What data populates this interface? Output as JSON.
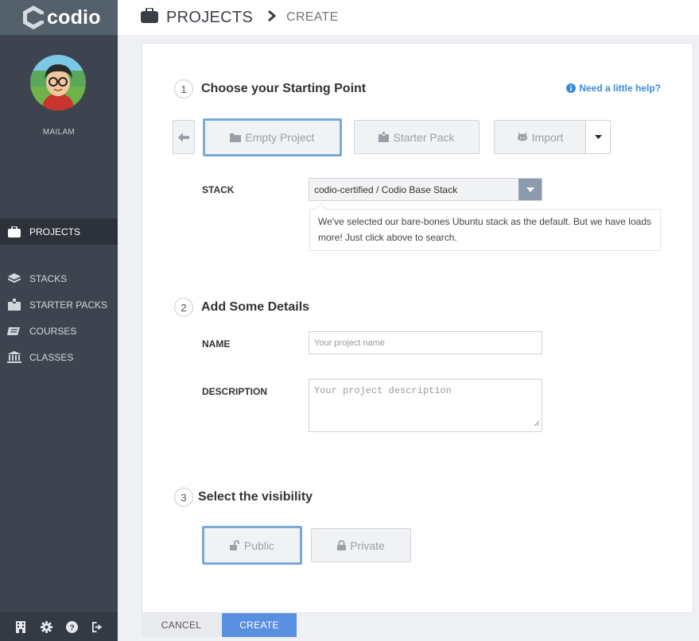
{
  "app": {
    "logo_text": "codio"
  },
  "user": {
    "name": "MAILAM"
  },
  "sidebar": {
    "items": [
      {
        "label": "PROJECTS",
        "icon": "briefcase-icon",
        "active": true
      },
      {
        "label": "STACKS",
        "icon": "layers-icon",
        "active": false
      },
      {
        "label": "STARTER PACKS",
        "icon": "box-icon",
        "active": false
      },
      {
        "label": "COURSES",
        "icon": "courses-icon",
        "active": false
      },
      {
        "label": "CLASSES",
        "icon": "institution-icon",
        "active": false
      }
    ],
    "footer_icons": [
      "building-icon",
      "gear-icon",
      "help-icon",
      "logout-icon"
    ]
  },
  "header": {
    "title": "PROJECTS",
    "subtitle": "CREATE"
  },
  "help": {
    "label": "Need a little help?"
  },
  "step1": {
    "number": "1",
    "title": "Choose your Starting Point",
    "options": {
      "empty": "Empty Project",
      "starter": "Starter Pack",
      "import": "Import"
    },
    "selected": "Empty Project",
    "stack_label": "STACK",
    "stack_value": "codio-certified / Codio Base Stack",
    "stack_note": "We've selected our bare-bones Ubuntu stack as the default. But we have loads more! Just click above to search."
  },
  "step2": {
    "number": "2",
    "title": "Add Some Details",
    "name_label": "NAME",
    "name_placeholder": "Your project name",
    "description_label": "DESCRIPTION",
    "description_placeholder": "Your project description"
  },
  "step3": {
    "number": "3",
    "title": "Select the visibility",
    "public_label": "Public",
    "private_label": "Private",
    "selected": "Public"
  },
  "actions": {
    "cancel": "CANCEL",
    "create": "CREATE"
  },
  "colors": {
    "accent": "#5b8fe0",
    "selected_border": "#7aa9dc",
    "sidebar": "#3d4450"
  }
}
